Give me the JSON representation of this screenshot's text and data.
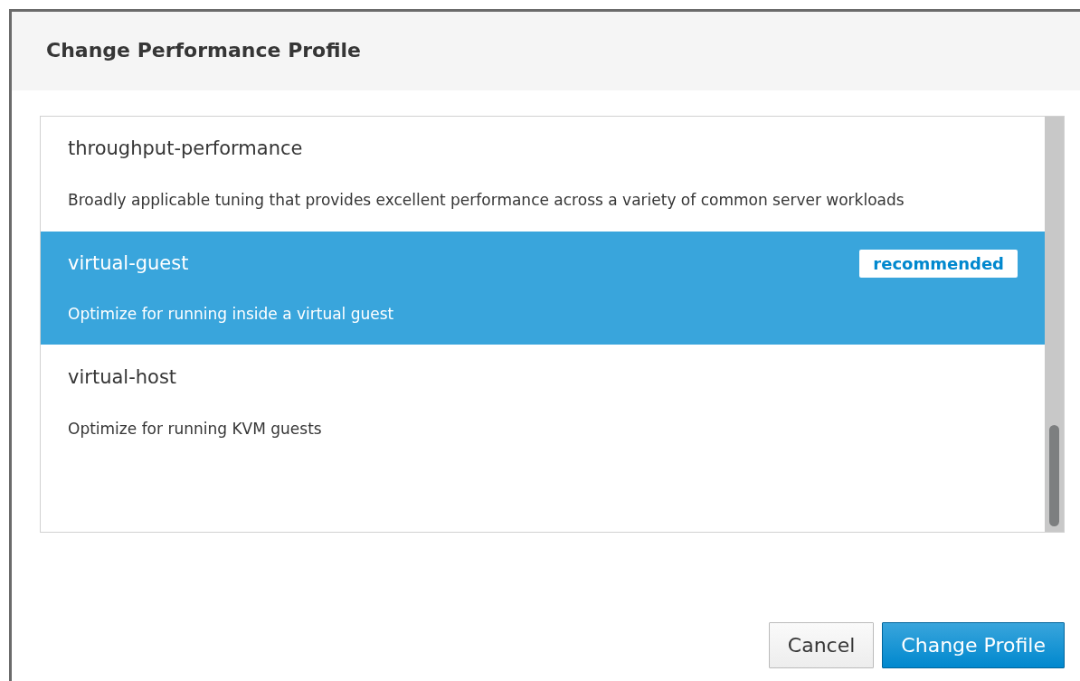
{
  "dialog": {
    "title": "Change Performance Profile",
    "profiles": [
      {
        "name": "throughput-performance",
        "description": "Broadly applicable tuning that provides excellent performance across a variety of common server workloads",
        "selected": false
      },
      {
        "name": "virtual-guest",
        "description": "Optimize for running inside a virtual guest",
        "selected": true,
        "badge": "recommended"
      },
      {
        "name": "virtual-host",
        "description": "Optimize for running KVM guests",
        "selected": false
      }
    ],
    "buttons": [
      {
        "label": "Cancel",
        "kind": "default"
      },
      {
        "label": "Change Profile",
        "kind": "primary"
      }
    ]
  }
}
